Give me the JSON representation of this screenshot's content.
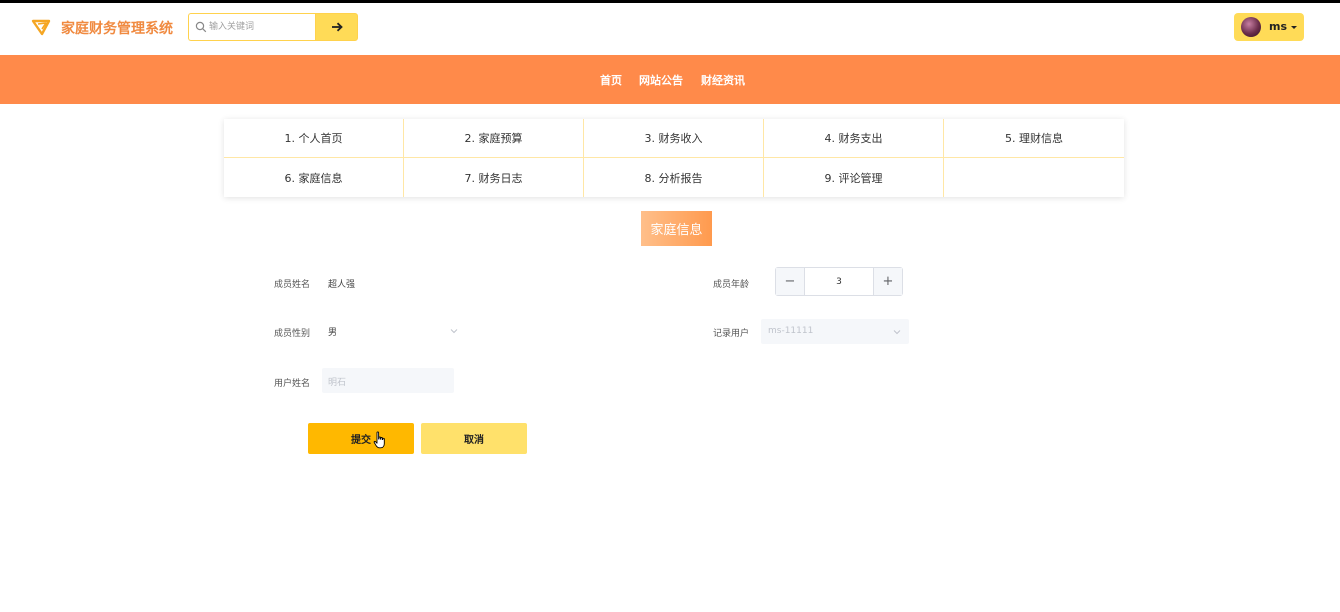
{
  "header": {
    "app_title": "家庭财务管理系统",
    "search": {
      "placeholder": "输入关键词",
      "value": ""
    },
    "search_button_icon": "arrow-right-icon",
    "user": {
      "name": "ms"
    }
  },
  "nav": {
    "items": [
      {
        "label": "首页"
      },
      {
        "label": "网站公告"
      },
      {
        "label": "财经资讯"
      }
    ]
  },
  "menu": {
    "items": [
      {
        "label": "1. 个人首页"
      },
      {
        "label": "2. 家庭预算"
      },
      {
        "label": "3. 财务收入"
      },
      {
        "label": "4. 财务支出"
      },
      {
        "label": "5. 理财信息"
      },
      {
        "label": "6. 家庭信息"
      },
      {
        "label": "7. 财务日志"
      },
      {
        "label": "8. 分析报告"
      },
      {
        "label": "9. 评论管理"
      },
      {
        "label": ""
      }
    ]
  },
  "form": {
    "title": "家庭信息",
    "member_name": {
      "label": "成员姓名",
      "value": "超人强"
    },
    "member_age": {
      "label": "成员年龄",
      "value": "3"
    },
    "member_gender": {
      "label": "成员性别",
      "value": "男"
    },
    "record_user": {
      "label": "记录用户",
      "value": "ms-11111"
    },
    "user_name": {
      "label": "用户姓名",
      "value": "明石"
    },
    "submit_label": "提交",
    "cancel_label": "取消"
  },
  "colors": {
    "brand_orange": "#ff8a4a",
    "accent_yellow": "#ffdb57",
    "submit": "#ffb800",
    "cancel": "#ffe16b"
  }
}
